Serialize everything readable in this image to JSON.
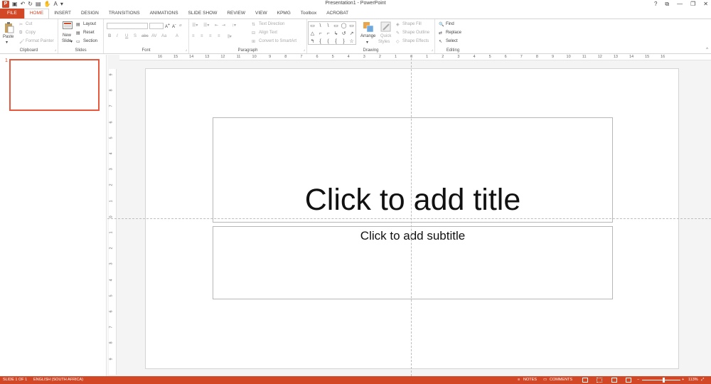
{
  "window": {
    "title": "Presentation1 - PowerPoint",
    "app_icon": "P",
    "controls": [
      "?",
      "⧉",
      "—",
      "❐",
      "✕"
    ]
  },
  "qat": {
    "icons": [
      "save-icon",
      "undo-icon",
      "redo-icon",
      "start-from-beginning-icon",
      "touch-mode-icon",
      "font-color-icon"
    ]
  },
  "tabs": [
    "FILE",
    "HOME",
    "INSERT",
    "DESIGN",
    "TRANSITIONS",
    "ANIMATIONS",
    "SLIDE SHOW",
    "REVIEW",
    "VIEW",
    "KPMG",
    "Toolbox",
    "ACROBAT"
  ],
  "active_tab_index": 1,
  "ribbon": {
    "clipboard": {
      "label": "Clipboard",
      "paste": "Paste",
      "cut": "Cut",
      "copy": "Copy",
      "format_painter": "Format Painter"
    },
    "slides": {
      "label": "Slides",
      "new_slide_1": "New",
      "new_slide_2": "Slide",
      "layout": "Layout",
      "reset": "Reset",
      "section": "Section"
    },
    "font": {
      "label": "Font",
      "bold": "B",
      "italic": "I",
      "underline": "U",
      "shadow": "S",
      "strike": "abc",
      "spacing": "AV",
      "case": "Aa",
      "clear": "A"
    },
    "paragraph": {
      "label": "Paragraph",
      "text_direction": "Text Direction",
      "align_text": "Align Text",
      "smartart": "Convert to SmartArt"
    },
    "drawing": {
      "label": "Drawing",
      "arrange": "Arrange",
      "quick_styles_1": "Quick",
      "quick_styles_2": "Styles",
      "shape_fill": "Shape Fill",
      "shape_outline": "Shape Outline",
      "shape_effects": "Shape Effects",
      "shapes": [
        "▭",
        "\\",
        "\\",
        "▭",
        "◯",
        "▭",
        "△",
        "⌐",
        "⌐",
        "↳",
        "↺",
        "↗",
        "↰",
        "{",
        "(",
        "{",
        "}",
        "☆"
      ]
    },
    "editing": {
      "label": "Editing",
      "find": "Find",
      "replace": "Replace",
      "select": "Select"
    }
  },
  "thumbnails": [
    {
      "number": "1"
    }
  ],
  "ruler": {
    "horizontal": [
      "16",
      "15",
      "14",
      "13",
      "12",
      "11",
      "10",
      "9",
      "8",
      "7",
      "6",
      "5",
      "4",
      "3",
      "2",
      "1",
      "0",
      "1",
      "2",
      "3",
      "4",
      "5",
      "6",
      "7",
      "8",
      "9",
      "10",
      "11",
      "12",
      "13",
      "14",
      "15",
      "16"
    ],
    "vertical": [
      "9",
      "8",
      "7",
      "6",
      "5",
      "4",
      "3",
      "2",
      "1",
      "0",
      "1",
      "2",
      "3",
      "4",
      "5",
      "6",
      "7",
      "8",
      "9"
    ]
  },
  "slide": {
    "title_placeholder": "Click to add title",
    "subtitle_placeholder": "Click to add subtitle"
  },
  "status": {
    "slide_info": "SLIDE 1 OF 1",
    "language": "ENGLISH (SOUTH AFRICA)",
    "notes": "NOTES",
    "comments": "COMMENTS",
    "zoom": "113%",
    "zoom_minus": "−",
    "zoom_plus": "+",
    "zoom_level": 0.55
  },
  "colors": {
    "accent": "#d24726",
    "thumb_border": "#e8583f"
  }
}
